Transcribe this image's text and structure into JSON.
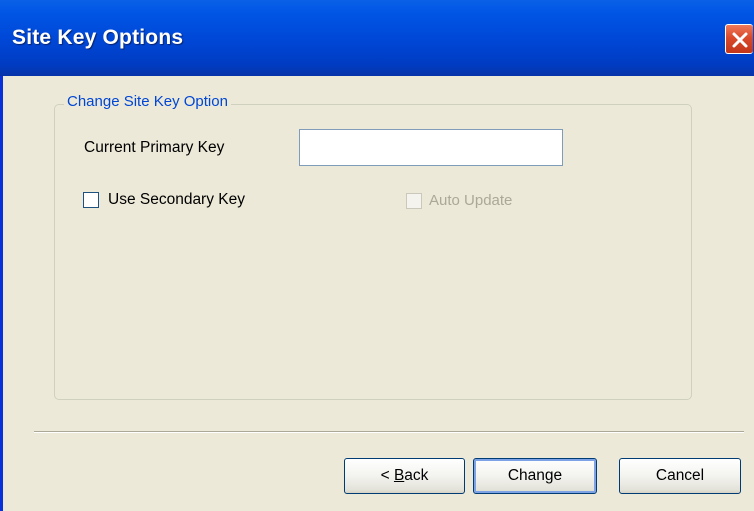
{
  "window": {
    "title": "Site Key Options",
    "close_icon": "close-x-icon"
  },
  "group": {
    "legend": "Change Site Key Option",
    "current_primary_key_label": "Current Primary Key",
    "current_primary_key_value": "",
    "use_secondary_key_label": "Use Secondary Key",
    "use_secondary_key_checked": false,
    "auto_update_label": "Auto Update",
    "auto_update_checked": false,
    "auto_update_enabled": false
  },
  "buttons": {
    "back_prefix": "< ",
    "back_mnemonic": "B",
    "back_rest": "ack",
    "change_label": "Change",
    "cancel_label": "Cancel"
  },
  "colors": {
    "titlebar": "#0046d5",
    "close_button": "#d94a2a",
    "legend_text": "#0046d5",
    "dialog_bg": "#ece9d8"
  }
}
